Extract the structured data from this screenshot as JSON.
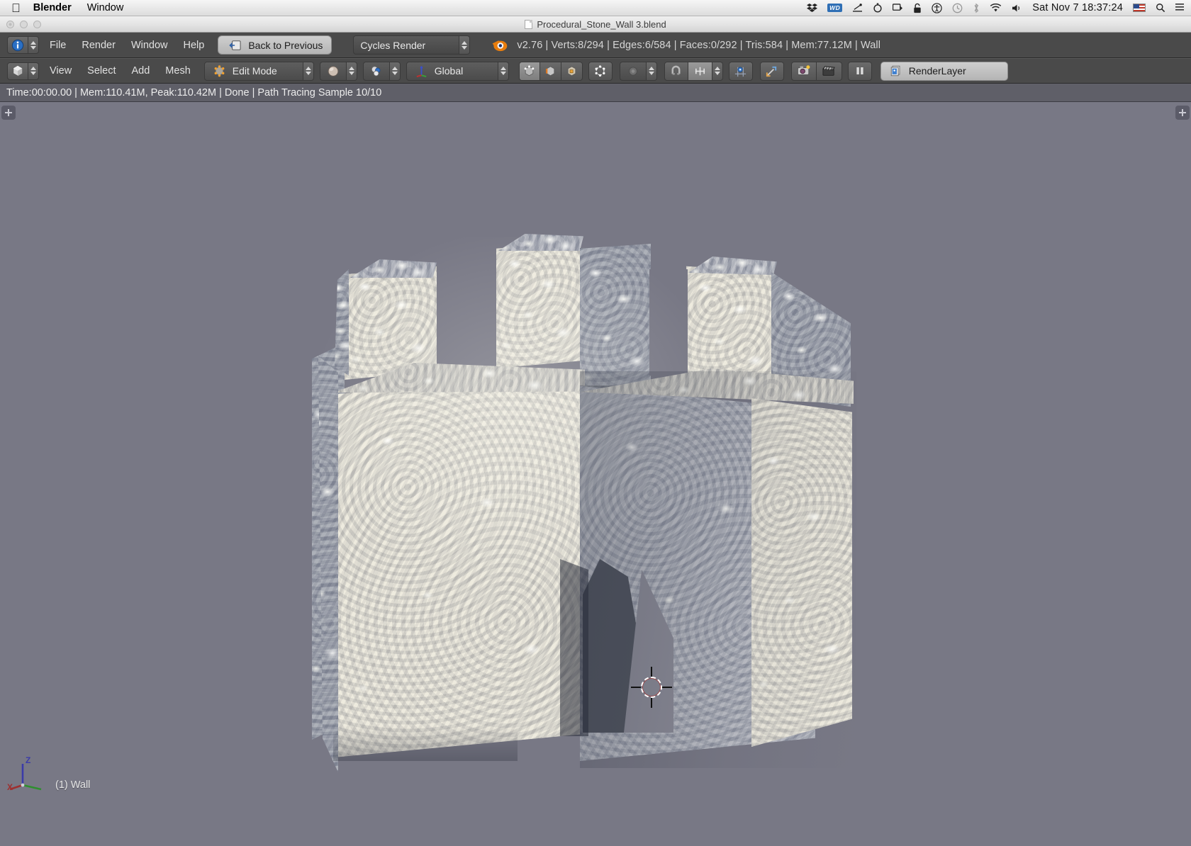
{
  "macos": {
    "apple_icon": "apple-logo-icon",
    "app_name": "Blender",
    "menus": [
      "Window"
    ],
    "status_icons": [
      {
        "name": "dropbox-icon",
        "glyph": "❖"
      },
      {
        "name": "western-digital-icon",
        "glyph": "WD"
      },
      {
        "name": "scanner-icon",
        "glyph": "✇"
      },
      {
        "name": "timer-icon",
        "glyph": "○"
      },
      {
        "name": "display-eject-icon",
        "glyph": "⏏"
      },
      {
        "name": "lock-icon",
        "glyph": "🔒"
      },
      {
        "name": "accessibility-icon",
        "glyph": "Ⓐ"
      },
      {
        "name": "time-machine-icon",
        "glyph": "↺"
      },
      {
        "name": "bluetooth-icon",
        "glyph": "ᛦ"
      },
      {
        "name": "wifi-icon",
        "glyph": "◠"
      },
      {
        "name": "volume-icon",
        "glyph": "🔊"
      }
    ],
    "clock": "Sat Nov 7  18:37:24",
    "input_flag": "us-flag-icon",
    "spotlight_icon": "search-icon",
    "notification_icon": "list-icon"
  },
  "window": {
    "title": "Procedural_Stone_Wall 3.blend",
    "traffic_lights": [
      "close",
      "minimize",
      "zoom"
    ]
  },
  "info_header": {
    "editor_type_icon": "info-editor-icon",
    "menus": [
      "File",
      "Render",
      "Window",
      "Help"
    ],
    "back_button": {
      "label": "Back to Previous",
      "icon": "back-arrow-icon"
    },
    "render_engine": "Cycles Render",
    "blender_logo_icon": "blender-logo-icon",
    "stats": "v2.76 | Verts:8/294 | Edges:6/584 | Faces:0/292 | Tris:584 | Mem:77.12M | Wall"
  },
  "view3d_header": {
    "editor_type_icon": "view3d-editor-icon",
    "menus": [
      "View",
      "Select",
      "Add",
      "Mesh"
    ],
    "mode": {
      "label": "Edit Mode",
      "icon": "edit-mode-icon"
    },
    "viewport_shading_icon": "shading-solid-icon",
    "scene_mode_icon": "texture-paint-icon",
    "transform_orientation": {
      "label": "Global",
      "icon": "axis-orientation-icon"
    },
    "select_modes": [
      {
        "name": "vertex-select-icon",
        "active": true
      },
      {
        "name": "edge-select-icon",
        "active": false
      },
      {
        "name": "face-select-icon",
        "active": false
      }
    ],
    "occlude_geometry_icon": "limit-selection-visible-icon",
    "proportional_edit_icon": "proportional-off-icon",
    "snap_magnet_icon": "snap-magnet-icon",
    "snap_target_icon": "snap-increment-icon",
    "pivot_icon": "pivot-median-point-icon",
    "manipulator_icon": "manipulator-icon",
    "render_snapshot_icon": "camera-icon",
    "render_animation_icon": "clapperboard-icon",
    "pause_icon": "pause-icon",
    "render_layer": {
      "label": "RenderLayer",
      "icon": "renderlayers-icon"
    }
  },
  "render_status": "Time:00:00.00 | Mem:110.41M, Peak:110.42M | Done | Path Tracing Sample 10/10",
  "viewport": {
    "object_label": "(1) Wall",
    "axis_labels": {
      "z": "Z",
      "x": "X",
      "y": "Y"
    },
    "axis_colors": {
      "z": "#3b3ba8",
      "x": "#9e3030",
      "y": "#2f8f2f"
    },
    "background_color": "#787885",
    "cursor_name": "3d-cursor",
    "corner_handles": [
      "+",
      "+"
    ],
    "model_name": "procedural-stone-wall"
  },
  "colors": {
    "header_bg": "#4a4a4a",
    "status_bg": "#5f5f68",
    "viewport_bg": "#787885",
    "stone_light": "#e7e2d2",
    "stone_shadow": "#868b99",
    "text": "#e0e0e0"
  }
}
